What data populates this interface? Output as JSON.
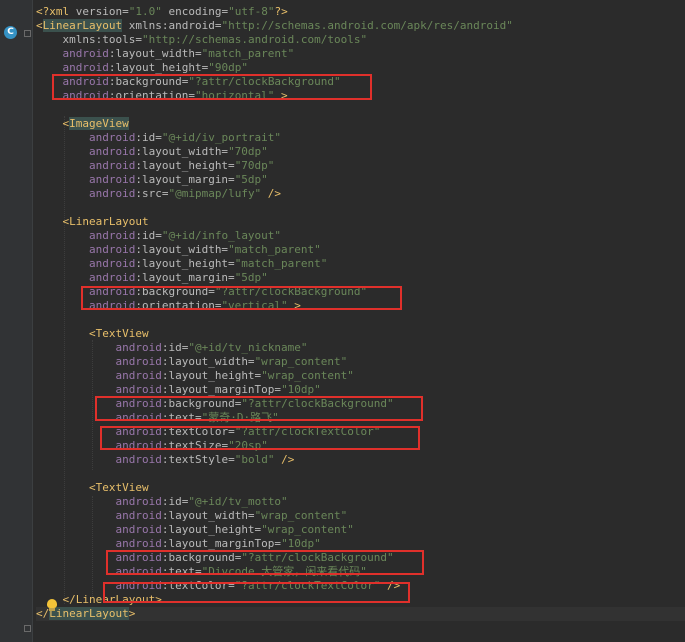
{
  "editor": {
    "lines": [
      {
        "indent": "",
        "parts": [
          [
            "p",
            "<?xml "
          ],
          [
            "a",
            "version="
          ],
          [
            "v",
            "\"1.0\""
          ],
          [
            "a",
            " encoding="
          ],
          [
            "v",
            "\"utf-8\""
          ],
          [
            "p",
            "?>"
          ]
        ]
      },
      {
        "indent": "",
        "parts": [
          [
            "t",
            "<"
          ],
          [
            "th",
            "LinearLayout"
          ],
          [
            "a",
            " xmlns:android="
          ],
          [
            "v",
            "\"http://schemas.android.com/apk/res/android\""
          ]
        ]
      },
      {
        "indent": "    ",
        "parts": [
          [
            "a",
            "xmlns:tools="
          ],
          [
            "v",
            "\"http://schemas.android.com/tools\""
          ]
        ]
      },
      {
        "indent": "    ",
        "parts": [
          [
            "ns",
            "android"
          ],
          [
            "a",
            ":layout_width="
          ],
          [
            "v",
            "\"match_parent\""
          ]
        ]
      },
      {
        "indent": "    ",
        "parts": [
          [
            "ns",
            "android"
          ],
          [
            "a",
            ":layout_height="
          ],
          [
            "v",
            "\"90dp\""
          ]
        ]
      },
      {
        "indent": "    ",
        "parts": [
          [
            "ns",
            "android"
          ],
          [
            "a",
            ":background="
          ],
          [
            "v",
            "\"?attr/clockBackground\""
          ]
        ]
      },
      {
        "indent": "    ",
        "parts": [
          [
            "ns",
            "android"
          ],
          [
            "a",
            ":orientation="
          ],
          [
            "v",
            "\"horizontal\""
          ],
          [
            "t",
            " >"
          ]
        ]
      },
      {
        "indent": "",
        "parts": []
      },
      {
        "indent": "    ",
        "parts": [
          [
            "t",
            "<"
          ],
          [
            "th",
            "ImageView"
          ]
        ]
      },
      {
        "indent": "        ",
        "parts": [
          [
            "ns",
            "android"
          ],
          [
            "a",
            ":id="
          ],
          [
            "v",
            "\"@+id/iv_portrait\""
          ]
        ]
      },
      {
        "indent": "        ",
        "parts": [
          [
            "ns",
            "android"
          ],
          [
            "a",
            ":layout_width="
          ],
          [
            "v",
            "\"70dp\""
          ]
        ]
      },
      {
        "indent": "        ",
        "parts": [
          [
            "ns",
            "android"
          ],
          [
            "a",
            ":layout_height="
          ],
          [
            "v",
            "\"70dp\""
          ]
        ]
      },
      {
        "indent": "        ",
        "parts": [
          [
            "ns",
            "android"
          ],
          [
            "a",
            ":layout_margin="
          ],
          [
            "v",
            "\"5dp\""
          ]
        ]
      },
      {
        "indent": "        ",
        "parts": [
          [
            "ns",
            "android"
          ],
          [
            "a",
            ":src="
          ],
          [
            "v",
            "\"@mipmap/lufy\""
          ],
          [
            "t",
            " />"
          ]
        ]
      },
      {
        "indent": "",
        "parts": []
      },
      {
        "indent": "    ",
        "parts": [
          [
            "t",
            "<"
          ],
          [
            "t",
            "LinearLayout"
          ]
        ]
      },
      {
        "indent": "        ",
        "parts": [
          [
            "ns",
            "android"
          ],
          [
            "a",
            ":id="
          ],
          [
            "v",
            "\"@+id/info_layout\""
          ]
        ]
      },
      {
        "indent": "        ",
        "parts": [
          [
            "ns",
            "android"
          ],
          [
            "a",
            ":layout_width="
          ],
          [
            "v",
            "\"match_parent\""
          ]
        ]
      },
      {
        "indent": "        ",
        "parts": [
          [
            "ns",
            "android"
          ],
          [
            "a",
            ":layout_height="
          ],
          [
            "v",
            "\"match_parent\""
          ]
        ]
      },
      {
        "indent": "        ",
        "parts": [
          [
            "ns",
            "android"
          ],
          [
            "a",
            ":layout_margin="
          ],
          [
            "v",
            "\"5dp\""
          ]
        ]
      },
      {
        "indent": "        ",
        "parts": [
          [
            "ns",
            "android"
          ],
          [
            "a",
            ":background="
          ],
          [
            "v",
            "\"?attr/clockBackground\""
          ]
        ]
      },
      {
        "indent": "        ",
        "parts": [
          [
            "ns",
            "android"
          ],
          [
            "a",
            ":orientation="
          ],
          [
            "v",
            "\"vertical\""
          ],
          [
            "t",
            " >"
          ]
        ]
      },
      {
        "indent": "",
        "parts": []
      },
      {
        "indent": "        ",
        "parts": [
          [
            "t",
            "<"
          ],
          [
            "t",
            "TextView"
          ]
        ]
      },
      {
        "indent": "            ",
        "parts": [
          [
            "ns",
            "android"
          ],
          [
            "a",
            ":id="
          ],
          [
            "v",
            "\"@+id/tv_nickname\""
          ]
        ]
      },
      {
        "indent": "            ",
        "parts": [
          [
            "ns",
            "android"
          ],
          [
            "a",
            ":layout_width="
          ],
          [
            "v",
            "\"wrap_content\""
          ]
        ]
      },
      {
        "indent": "            ",
        "parts": [
          [
            "ns",
            "android"
          ],
          [
            "a",
            ":layout_height="
          ],
          [
            "v",
            "\"wrap_content\""
          ]
        ]
      },
      {
        "indent": "            ",
        "parts": [
          [
            "ns",
            "android"
          ],
          [
            "a",
            ":layout_marginTop="
          ],
          [
            "v",
            "\"10dp\""
          ]
        ]
      },
      {
        "indent": "            ",
        "parts": [
          [
            "ns",
            "android"
          ],
          [
            "a",
            ":background="
          ],
          [
            "v",
            "\"?attr/clockBackground\""
          ]
        ]
      },
      {
        "indent": "            ",
        "parts": [
          [
            "ns",
            "android"
          ],
          [
            "a",
            ":text="
          ],
          [
            "v",
            "\"蒙奇·D·路飞\""
          ]
        ]
      },
      {
        "indent": "            ",
        "parts": [
          [
            "ns",
            "android"
          ],
          [
            "a",
            ":textColor="
          ],
          [
            "v",
            "\"?attr/clockTextColor\""
          ]
        ]
      },
      {
        "indent": "            ",
        "parts": [
          [
            "ns",
            "android"
          ],
          [
            "a",
            ":textSize="
          ],
          [
            "v",
            "\"20sp\""
          ]
        ]
      },
      {
        "indent": "            ",
        "parts": [
          [
            "ns",
            "android"
          ],
          [
            "a",
            ":textStyle="
          ],
          [
            "v",
            "\"bold\""
          ],
          [
            "t",
            " />"
          ]
        ]
      },
      {
        "indent": "",
        "parts": []
      },
      {
        "indent": "        ",
        "parts": [
          [
            "t",
            "<"
          ],
          [
            "t",
            "TextView"
          ]
        ]
      },
      {
        "indent": "            ",
        "parts": [
          [
            "ns",
            "android"
          ],
          [
            "a",
            ":id="
          ],
          [
            "v",
            "\"@+id/tv_motto\""
          ]
        ]
      },
      {
        "indent": "            ",
        "parts": [
          [
            "ns",
            "android"
          ],
          [
            "a",
            ":layout_width="
          ],
          [
            "v",
            "\"wrap_content\""
          ]
        ]
      },
      {
        "indent": "            ",
        "parts": [
          [
            "ns",
            "android"
          ],
          [
            "a",
            ":layout_height="
          ],
          [
            "v",
            "\"wrap_content\""
          ]
        ]
      },
      {
        "indent": "            ",
        "parts": [
          [
            "ns",
            "android"
          ],
          [
            "a",
            ":layout_marginTop="
          ],
          [
            "v",
            "\"10dp\""
          ]
        ]
      },
      {
        "indent": "            ",
        "parts": [
          [
            "ns",
            "android"
          ],
          [
            "a",
            ":background="
          ],
          [
            "v",
            "\"?attr/clockBackground\""
          ]
        ]
      },
      {
        "indent": "            ",
        "parts": [
          [
            "ns",
            "android"
          ],
          [
            "a",
            ":text="
          ],
          [
            "v",
            "\"Divcode 大管家，闲来看代码\""
          ]
        ]
      },
      {
        "indent": "            ",
        "parts": [
          [
            "ns",
            "android"
          ],
          [
            "a",
            ":textColor="
          ],
          [
            "v",
            "\"?attr/clockTextColor\""
          ],
          [
            "t",
            " />"
          ]
        ]
      },
      {
        "indent": "    ",
        "parts": [
          [
            "t",
            "</"
          ],
          [
            "t",
            "LinearLayout"
          ],
          [
            "t",
            ">"
          ]
        ]
      },
      {
        "indent": "",
        "parts": [
          [
            "t",
            "</"
          ],
          [
            "th",
            "LinearLayout"
          ],
          [
            "t",
            ">"
          ]
        ]
      }
    ]
  },
  "gutter": {
    "class_icon_letter": "C",
    "class_icon_name": "class-icon",
    "bulb_icon_name": "lightbulb-icon"
  },
  "colors": {
    "background": "#2b2b2b",
    "highlight_box": "#e0302b",
    "attr_value": "#6a8759",
    "tag": "#e8bf6a",
    "namespace": "#9876aa"
  }
}
